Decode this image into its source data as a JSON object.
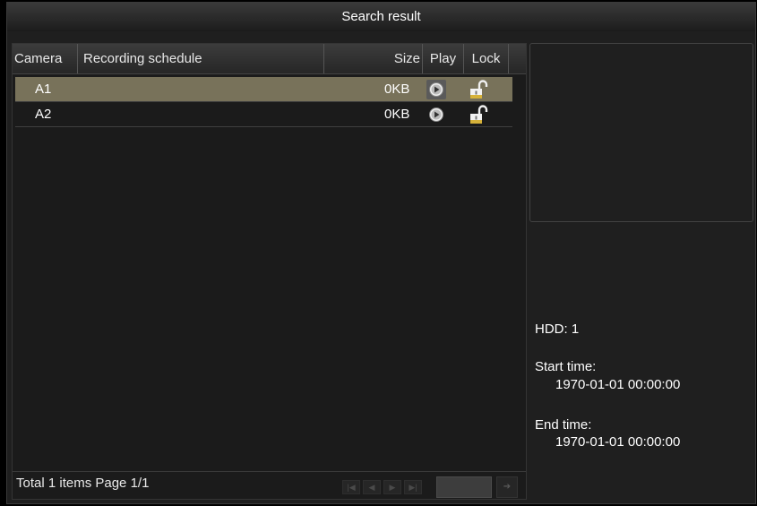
{
  "window": {
    "title": "Search result"
  },
  "table": {
    "columns": {
      "camera": "Camera",
      "schedule": "Recording schedule",
      "size": "Size",
      "play": "Play",
      "lock": "Lock"
    },
    "rows": [
      {
        "camera": "A1",
        "schedule": "",
        "size": "0KB",
        "selected": true
      },
      {
        "camera": "A2",
        "schedule": "",
        "size": "0KB",
        "selected": false
      }
    ]
  },
  "footer": {
    "total_text": "Total 1 items Page 1/1"
  },
  "info": {
    "hdd": "HDD: 1",
    "start_label": "Start time:",
    "start_value": "1970-01-01 00:00:00",
    "end_label": "End time:",
    "end_value": "1970-01-01 00:00:00"
  },
  "colors": {
    "selected_row": "#78725a",
    "background": "#1f1f1f",
    "lock_gold": "#d6b23a"
  },
  "icons": [
    "play-icon",
    "unlock-icon",
    "first-page-icon",
    "prev-page-icon",
    "next-page-icon",
    "last-page-icon",
    "go-icon"
  ]
}
